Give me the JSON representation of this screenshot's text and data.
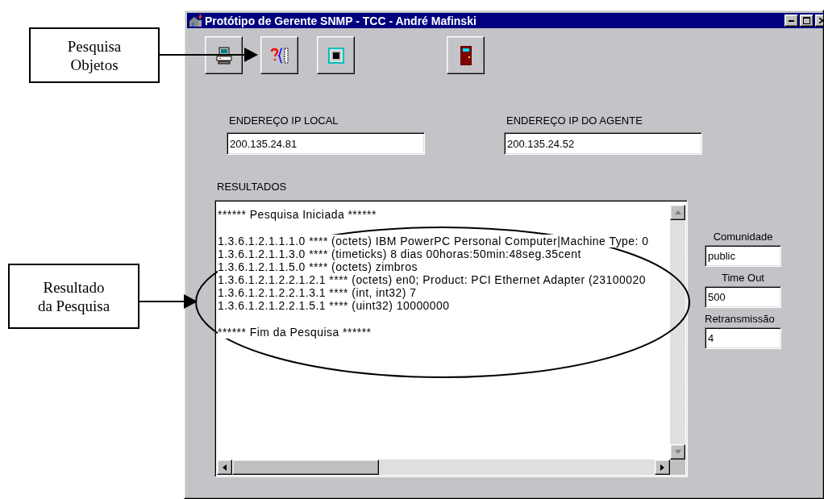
{
  "window": {
    "title": "Protótipo de Gerente SNMP - TCC - André Mafinski"
  },
  "local_ip": {
    "label": "ENDEREÇO IP LOCAL",
    "value": "200.135.24.81"
  },
  "agent_ip": {
    "label": "ENDEREÇO IP DO AGENTE",
    "value": "200.135.24.52"
  },
  "results": {
    "label": "RESULTADOS",
    "blocks": [
      [
        "****** Pesquisa Iniciada ******"
      ],
      [
        "1.3.6.1.2.1.1.1.0 **** (octets) IBM PowerPC Personal Computer|Machine Type: 0",
        "1.3.6.1.2.1.1.3.0 **** (timeticks) 8 dias 00horas:50min:48seg.35cent",
        "1.3.6.1.2.1.1.5.0 **** (octets) zimbros",
        "1.3.6.1.2.1.2.2.1.2.1 **** (octets) en0; Product: PCI Ethernet Adapter (23100020",
        "1.3.6.1.2.1.2.2.1.3.1 **** (int, int32) 7",
        "1.3.6.1.2.1.2.2.1.5.1 **** (uint32) 10000000"
      ],
      [
        "****** Fim da Pesquisa ******"
      ]
    ]
  },
  "settings": [
    {
      "label": "Comunidade",
      "value": "public"
    },
    {
      "label": "Time Out",
      "value": "500"
    },
    {
      "label": "Retransmissão",
      "value": "4"
    }
  ],
  "annotations": [
    {
      "lines": [
        "Pesquisa",
        "Objetos"
      ]
    },
    {
      "lines": [
        "Resultado",
        "da Pesquisa"
      ]
    }
  ]
}
